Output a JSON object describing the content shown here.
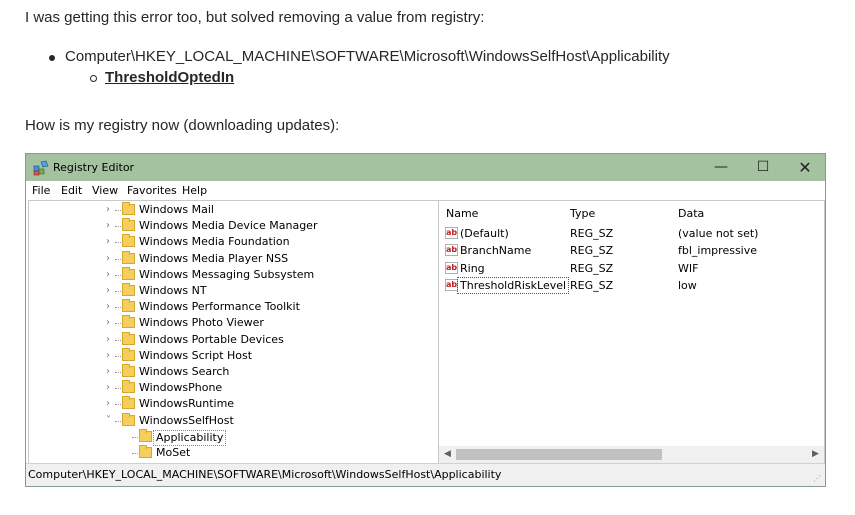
{
  "post": {
    "intro": "I was getting this error too, but solved removing a value from registry:",
    "registry_path": "Computer\\HKEY_LOCAL_MACHINE\\SOFTWARE\\Microsoft\\WindowsSelfHost\\Applicability",
    "value_name": "ThresholdOptedIn",
    "followup": "How is my registry now (downloading updates):"
  },
  "regedit": {
    "title": "Registry Editor",
    "controls": {
      "minimize": "—",
      "maximize": "☐",
      "close": "✕"
    },
    "menu": [
      "File",
      "Edit",
      "View",
      "Favorites",
      "Help"
    ],
    "tree": [
      {
        "label": "Windows Mail",
        "arrow": "›"
      },
      {
        "label": "Windows Media Device Manager",
        "arrow": "›"
      },
      {
        "label": "Windows Media Foundation",
        "arrow": "›"
      },
      {
        "label": "Windows Media Player NSS",
        "arrow": "›"
      },
      {
        "label": "Windows Messaging Subsystem",
        "arrow": "›"
      },
      {
        "label": "Windows NT",
        "arrow": "›"
      },
      {
        "label": "Windows Performance Toolkit",
        "arrow": "›"
      },
      {
        "label": "Windows Photo Viewer",
        "arrow": "›"
      },
      {
        "label": "Windows Portable Devices",
        "arrow": "›"
      },
      {
        "label": "Windows Script Host",
        "arrow": "›"
      },
      {
        "label": "Windows Search",
        "arrow": "›"
      },
      {
        "label": "WindowsPhone",
        "arrow": "›"
      },
      {
        "label": "WindowsRuntime",
        "arrow": "›"
      },
      {
        "label": "WindowsSelfHost",
        "arrow": "˅"
      },
      {
        "label": "Applicability",
        "arrow": ""
      },
      {
        "label": "MoSet",
        "arrow": ""
      }
    ],
    "columns": {
      "name": "Name",
      "type": "Type",
      "data": "Data"
    },
    "values": [
      {
        "name": "(Default)",
        "type": "REG_SZ",
        "data": "(value not set)"
      },
      {
        "name": "BranchName",
        "type": "REG_SZ",
        "data": "fbl_impressive"
      },
      {
        "name": "Ring",
        "type": "REG_SZ",
        "data": "WIF"
      },
      {
        "name": "ThresholdRiskLevel",
        "type": "REG_SZ",
        "data": "low"
      }
    ],
    "status": "Computer\\HKEY_LOCAL_MACHINE\\SOFTWARE\\Microsoft\\WindowsSelfHost\\Applicability",
    "icons": {
      "value": "string-value-icon",
      "folder": "folder-icon",
      "app": "registry-editor-icon"
    },
    "accent": "#a4c2a0"
  }
}
